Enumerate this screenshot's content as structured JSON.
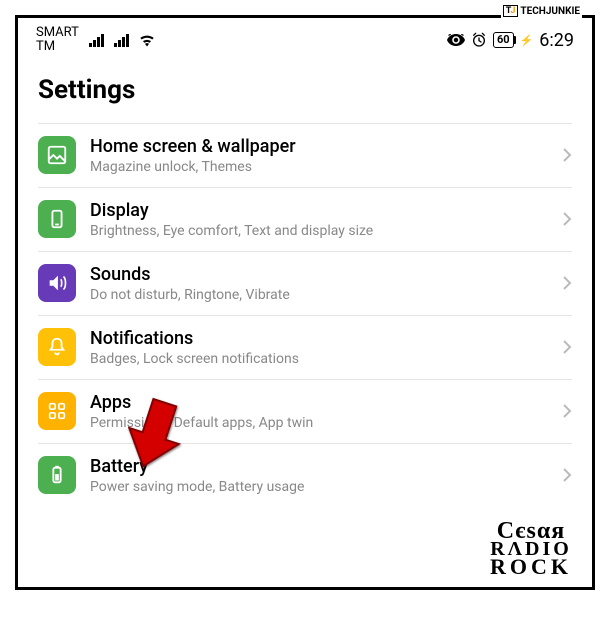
{
  "watermarks": {
    "tj": "TECHJUNKIE",
    "cesar_line1": "Cєsαя",
    "cesar_line2": "RΛDIO",
    "cesar_line3": "ROCK"
  },
  "status": {
    "carrier_line1": "SMART",
    "carrier_line2": "TM",
    "battery": "60",
    "time": "6:29"
  },
  "title": "Settings",
  "items": [
    {
      "title": "Home screen & wallpaper",
      "sub": "Magazine unlock, Themes"
    },
    {
      "title": "Display",
      "sub": "Brightness, Eye comfort, Text and display size"
    },
    {
      "title": "Sounds",
      "sub": "Do not disturb, Ringtone, Vibrate"
    },
    {
      "title": "Notifications",
      "sub": "Badges, Lock screen notifications"
    },
    {
      "title": "Apps",
      "sub": "Permissions, Default apps, App twin"
    },
    {
      "title": "Battery",
      "sub": "Power saving mode, Battery usage"
    }
  ]
}
